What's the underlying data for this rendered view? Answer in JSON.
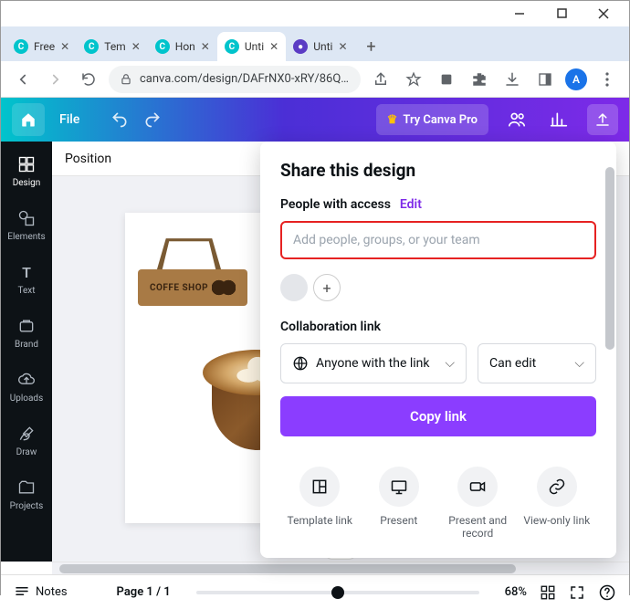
{
  "window": {
    "controls": [
      "minimize",
      "maximize",
      "close"
    ]
  },
  "tabs": [
    {
      "label": "Free",
      "favicon": "canva"
    },
    {
      "label": "Tem",
      "favicon": "canva"
    },
    {
      "label": "Hon",
      "favicon": "canva"
    },
    {
      "label": "Unti",
      "favicon": "canva",
      "active": true
    },
    {
      "label": "Unti",
      "favicon": "other"
    }
  ],
  "urlbar": {
    "url": "canva.com/design/DAFrNX0-xRY/86Q_OS-B5...",
    "avatar_letter": "A"
  },
  "canva_top": {
    "file": "File",
    "try_pro": "Try Canva Pro"
  },
  "sidebar": [
    {
      "id": "design",
      "label": "Design"
    },
    {
      "id": "elements",
      "label": "Elements"
    },
    {
      "id": "text",
      "label": "Text"
    },
    {
      "id": "brand",
      "label": "Brand"
    },
    {
      "id": "uploads",
      "label": "Uploads"
    },
    {
      "id": "draw",
      "label": "Draw"
    },
    {
      "id": "projects",
      "label": "Projects"
    }
  ],
  "toolbar": {
    "position": "Position"
  },
  "design": {
    "sign_text": "COFFE SHOP"
  },
  "share": {
    "title": "Share this design",
    "access_label": "People with access",
    "edit": "Edit",
    "input_placeholder": "Add people, groups, or your team",
    "collab": "Collaboration link",
    "link_scope": "Anyone with the link",
    "permission": "Can edit",
    "copy": "Copy link",
    "actions": [
      {
        "id": "template",
        "label": "Template link"
      },
      {
        "id": "present",
        "label": "Present"
      },
      {
        "id": "record",
        "label": "Present and record"
      },
      {
        "id": "viewonly",
        "label": "View-only link"
      }
    ]
  },
  "bottom": {
    "notes": "Notes",
    "page": "Page 1 / 1",
    "zoom": "68%"
  }
}
